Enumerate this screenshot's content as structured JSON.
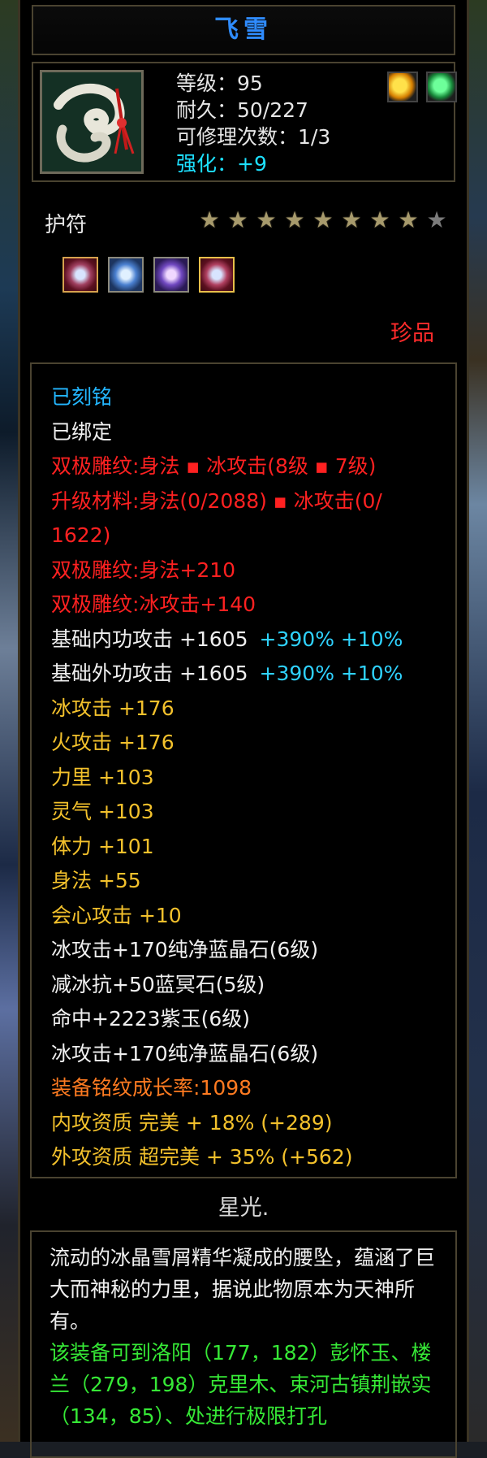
{
  "item": {
    "name": "飞雪",
    "level": "等级：95",
    "durability": "耐久：50/227",
    "repairs": "可修理次数：1/3",
    "enhance": "强化：+9",
    "type": "护符",
    "stars_total": 9,
    "stars_lit": 8,
    "rarity": "珍品",
    "signature": "星光."
  },
  "gems": [
    "red",
    "blue",
    "purple",
    "red"
  ],
  "attributes": [
    {
      "text": "已刻铭",
      "color": "cyan"
    },
    {
      "text": "已绑定",
      "color": "white"
    },
    {
      "text": "双极雕纹:身法 ▪ 冰攻击(8级 ▪ 7级)",
      "color": "red"
    },
    {
      "text": "升级材料:身法(0/2088) ▪ 冰攻击(0/",
      "color": "red"
    },
    {
      "text": "1622)",
      "color": "red"
    },
    {
      "text": "双极雕纹:身法+210",
      "color": "red"
    },
    {
      "text": "双极雕纹:冰攻击+140",
      "color": "red"
    },
    {
      "text": "基础内功攻击  +1605",
      "extra": "+390%  +10%",
      "color": "white"
    },
    {
      "text": "基础外功攻击  +1605",
      "extra": "+390%  +10%",
      "color": "white"
    },
    {
      "text": "冰攻击  +176",
      "color": "yellow"
    },
    {
      "text": "火攻击  +176",
      "color": "yellow"
    },
    {
      "text": "力里  +103",
      "color": "yellow"
    },
    {
      "text": "灵气  +103",
      "color": "yellow"
    },
    {
      "text": "体力  +101",
      "color": "yellow"
    },
    {
      "text": "身法  +55",
      "color": "yellow"
    },
    {
      "text": "会心攻击  +10",
      "color": "yellow"
    },
    {
      "text": "冰攻击+170纯净蓝晶石(6级)",
      "color": "white"
    },
    {
      "text": "减冰抗+50蓝冥石(5级)",
      "color": "white"
    },
    {
      "text": "命中+2223紫玉(6级)",
      "color": "white"
    },
    {
      "text": "冰攻击+170纯净蓝晶石(6级)",
      "color": "white"
    },
    {
      "text": "装备铭纹成长率:1098",
      "color": "orange"
    },
    {
      "text": "内攻资质  完美  +  18%  (+289)",
      "color": "yellow"
    },
    {
      "text": "外攻资质  超完美  +  35%  (+562)",
      "color": "yellow"
    }
  ],
  "description": {
    "lore": "流动的冰晶雪屑精华凝成的腰坠，蕴涵了巨大而神秘的力里，据说此物原本为天神所有。",
    "hint": "该装备可到洛阳（177，182）彭怀玉、楼兰（279，198）克里木、束河古镇荆嵌实（134，85）、处进行极限打孔"
  },
  "colors": {
    "title": "#2f8cff",
    "enhance": "#1de0ff",
    "rarity": "#ff2b2b",
    "attr_red": "#ff2121",
    "attr_yellow": "#f3c12c",
    "attr_orange": "#ff7b21",
    "attr_cyan": "#23b6ff",
    "hint_green": "#36e836"
  }
}
